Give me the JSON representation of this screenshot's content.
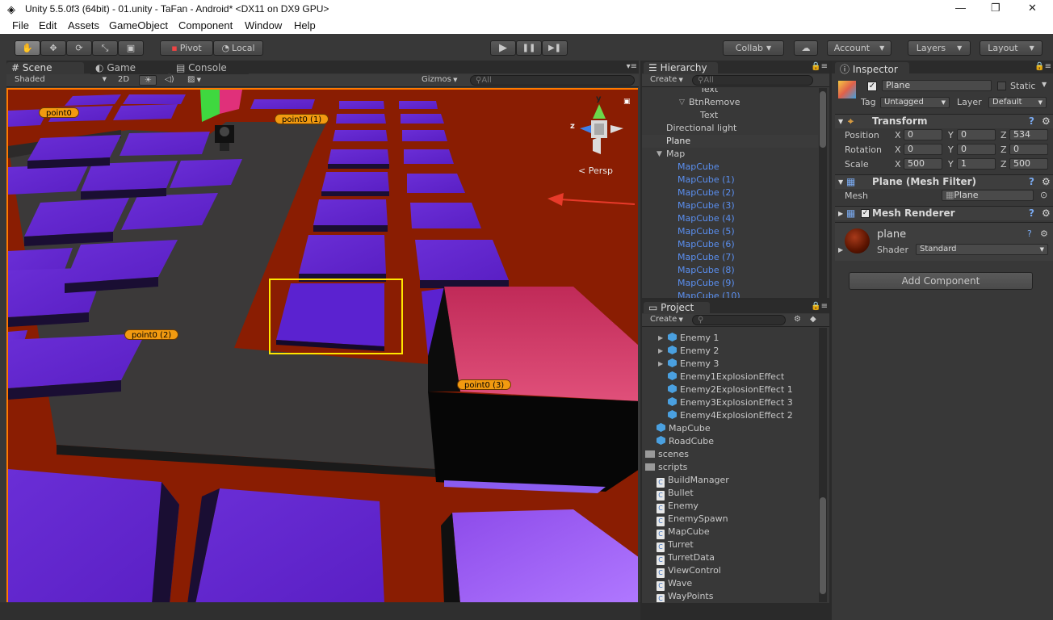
{
  "window": {
    "title": "Unity 5.5.0f3 (64bit) - 01.unity - TaFan - Android* <DX11 on DX9 GPU>",
    "minimize": "—",
    "maximize": "❐",
    "close": "✕"
  },
  "menu": [
    "File",
    "Edit",
    "Assets",
    "GameObject",
    "Component",
    "Window",
    "Help"
  ],
  "toolbar": {
    "pivot": "Pivot",
    "local": "Local",
    "collab": "Collab",
    "account": "Account",
    "layers": "Layers",
    "layout": "Layout",
    "play": "▶",
    "pause": "❚❚",
    "step": "▶❚"
  },
  "scene": {
    "tabs": [
      "Scene",
      "Game",
      "Console"
    ],
    "shading": "Shaded",
    "mode2d": "2D",
    "gizmos": "Gizmos",
    "search_placeholder": "All",
    "persp": "Persp",
    "axis_y": "y",
    "axis_z": "z",
    "waypoints": [
      "point0",
      "point0 (1)",
      "point0 (2)",
      "point0 (3)"
    ]
  },
  "hierarchy": {
    "tab": "Hierarchy",
    "create": "Create",
    "search_placeholder": "All",
    "rows": [
      {
        "label": "Text",
        "indent": 72,
        "blue": false
      },
      {
        "label": "BtnRemove",
        "indent": 58,
        "blue": false,
        "arrow": "▽"
      },
      {
        "label": "Text",
        "indent": 72,
        "blue": false
      },
      {
        "label": "Directional light",
        "indent": 30,
        "blue": false
      },
      {
        "label": "Plane",
        "indent": 30,
        "blue": false,
        "selected": true
      },
      {
        "label": "Map",
        "indent": 30,
        "blue": false,
        "arrow": "▼"
      },
      {
        "label": "MapCube",
        "indent": 44,
        "blue": true
      },
      {
        "label": "MapCube (1)",
        "indent": 44,
        "blue": true
      },
      {
        "label": "MapCube (2)",
        "indent": 44,
        "blue": true
      },
      {
        "label": "MapCube (3)",
        "indent": 44,
        "blue": true
      },
      {
        "label": "MapCube (4)",
        "indent": 44,
        "blue": true
      },
      {
        "label": "MapCube (5)",
        "indent": 44,
        "blue": true
      },
      {
        "label": "MapCube (6)",
        "indent": 44,
        "blue": true
      },
      {
        "label": "MapCube (7)",
        "indent": 44,
        "blue": true
      },
      {
        "label": "MapCube (8)",
        "indent": 44,
        "blue": true
      },
      {
        "label": "MapCube (9)",
        "indent": 44,
        "blue": true
      },
      {
        "label": "MapCube (10)",
        "indent": 44,
        "blue": true
      }
    ]
  },
  "project": {
    "tab": "Project",
    "create": "Create",
    "rows": [
      {
        "label": "Enemy 1",
        "type": "prefab",
        "indent": 32,
        "arrow": true
      },
      {
        "label": "Enemy 2",
        "type": "prefab",
        "indent": 32,
        "arrow": true
      },
      {
        "label": "Enemy 3",
        "type": "prefab",
        "indent": 32,
        "arrow": true
      },
      {
        "label": "Enemy1ExplosionEffect",
        "type": "prefab",
        "indent": 32
      },
      {
        "label": "Enemy2ExplosionEffect 1",
        "type": "prefab",
        "indent": 32
      },
      {
        "label": "Enemy3ExplosionEffect 3",
        "type": "prefab",
        "indent": 32
      },
      {
        "label": "Enemy4ExplosionEffect 2",
        "type": "prefab",
        "indent": 32
      },
      {
        "label": "MapCube",
        "type": "prefab",
        "indent": 18
      },
      {
        "label": "RoadCube",
        "type": "prefab",
        "indent": 18
      },
      {
        "label": "scenes",
        "type": "folder",
        "indent": 4,
        "arrow": "▶"
      },
      {
        "label": "scripts",
        "type": "folder",
        "indent": 4,
        "arrow": "▼"
      },
      {
        "label": "BuildManager",
        "type": "script",
        "indent": 18
      },
      {
        "label": "Bullet",
        "type": "script",
        "indent": 18
      },
      {
        "label": "Enemy",
        "type": "script",
        "indent": 18
      },
      {
        "label": "EnemySpawn",
        "type": "script",
        "indent": 18
      },
      {
        "label": "MapCube",
        "type": "script",
        "indent": 18
      },
      {
        "label": "Turret",
        "type": "script",
        "indent": 18
      },
      {
        "label": "TurretData",
        "type": "script",
        "indent": 18
      },
      {
        "label": "ViewControl",
        "type": "script",
        "indent": 18
      },
      {
        "label": "Wave",
        "type": "script",
        "indent": 18
      },
      {
        "label": "WayPoints",
        "type": "script",
        "indent": 18
      }
    ]
  },
  "inspector": {
    "tab": "Inspector",
    "name": "Plane",
    "static": "Static",
    "tag_label": "Tag",
    "tag": "Untagged",
    "layer_label": "Layer",
    "layer": "Default",
    "transform": {
      "title": "Transform",
      "position_label": "Position",
      "rotation_label": "Rotation",
      "scale_label": "Scale",
      "axis_x": "X",
      "axis_y": "Y",
      "axis_z": "Z",
      "position": [
        "0",
        "0",
        "534"
      ],
      "rotation": [
        "0",
        "0",
        "0"
      ],
      "scale": [
        "500",
        "1",
        "500"
      ]
    },
    "mesh_filter": {
      "title": "Plane (Mesh Filter)",
      "mesh_label": "Mesh",
      "mesh": "Plane"
    },
    "mesh_renderer": {
      "title": "Mesh Renderer"
    },
    "material": {
      "name": "plane",
      "shader_label": "Shader",
      "shader": "Standard"
    },
    "add_component": "Add Component"
  },
  "colors": {
    "ground": "#8a1d02",
    "tile": "#5a1fc4",
    "road": "#3a3838",
    "selection": "#ffe600",
    "waypoint": "#f29a10",
    "pink_block": "#d43a66"
  }
}
